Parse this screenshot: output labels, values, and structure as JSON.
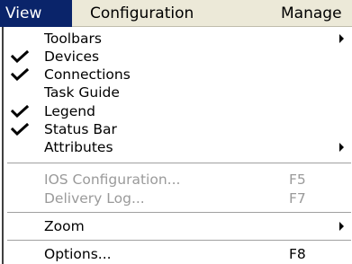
{
  "menubar": {
    "items": [
      {
        "label": "View",
        "active": true
      },
      {
        "label": "Configuration"
      },
      {
        "label": "Manage"
      }
    ]
  },
  "menu": {
    "items": [
      {
        "label": "Toolbars",
        "submenu": true
      },
      {
        "label": "Devices",
        "checked": true
      },
      {
        "label": "Connections",
        "checked": true
      },
      {
        "label": "Task Guide"
      },
      {
        "label": "Legend",
        "checked": true
      },
      {
        "label": "Status Bar",
        "checked": true
      },
      {
        "label": "Attributes",
        "submenu": true
      },
      {
        "label": "IOS Configuration...",
        "shortcut": "F5",
        "disabled": true
      },
      {
        "label": "Delivery Log...",
        "shortcut": "F7",
        "disabled": true
      },
      {
        "label": "Zoom",
        "submenu": true
      },
      {
        "label": "Options...",
        "shortcut": "F8"
      }
    ]
  },
  "colors": {
    "menubar_bg": "#ece9d8",
    "highlight": "#0a246a",
    "disabled_text": "#9a9a9a"
  }
}
